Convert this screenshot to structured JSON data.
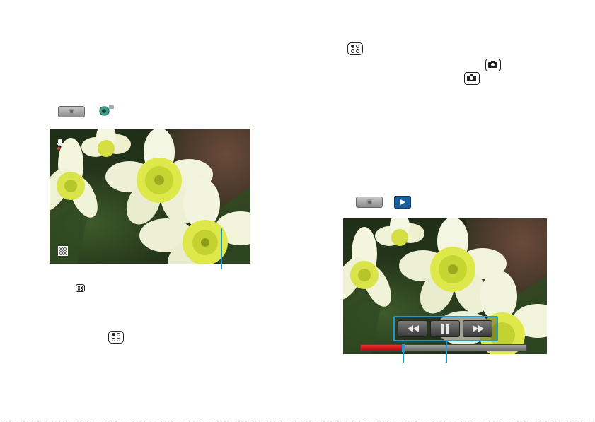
{
  "page": {
    "background": "#ffffff",
    "accent": "#1e9ad6"
  },
  "icons": {
    "menu_key": "menu-key-icon",
    "camera_key": "camera-key-icon",
    "home_button": "home-button-icon",
    "camcorder": "camcorder-icon",
    "play": "play-icon",
    "mic": "microphone-icon",
    "thumbnail": "thumbnail-icon"
  },
  "video_player": {
    "controls": {
      "rewind": "rewind-icon",
      "pause": "pause-icon",
      "fast_forward": "fast-forward-icon"
    },
    "progress": 0.25,
    "progress_color": "#d8161b"
  }
}
